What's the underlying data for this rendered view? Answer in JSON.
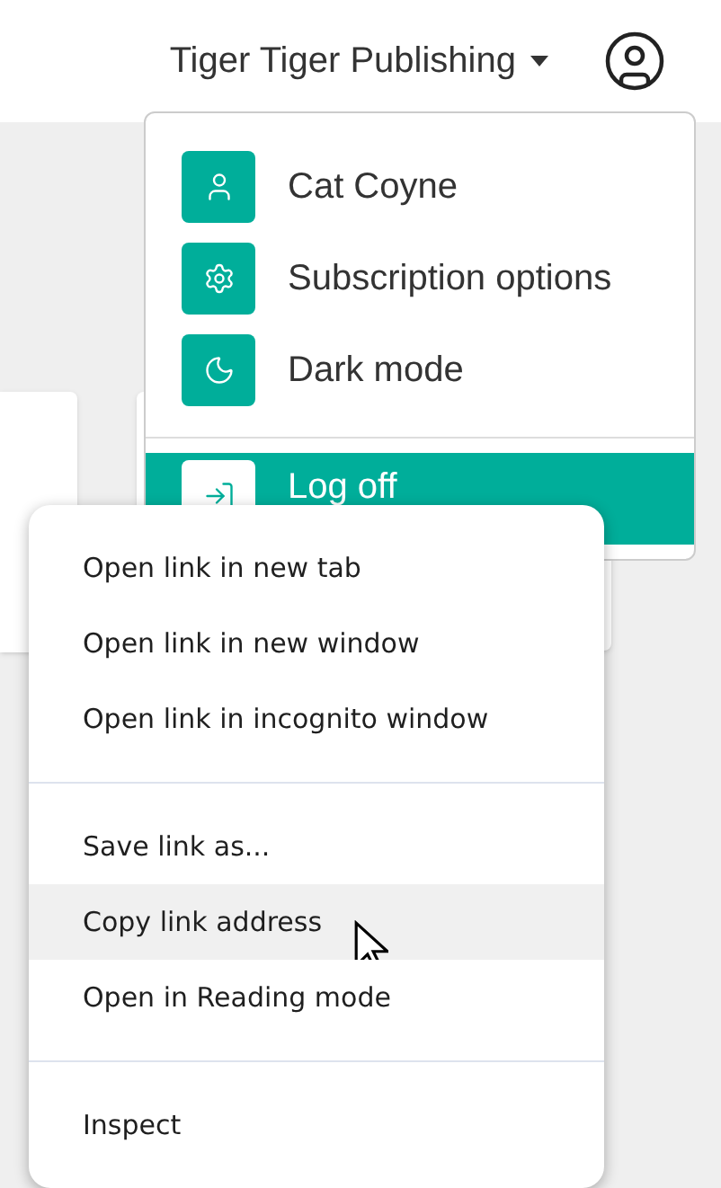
{
  "header": {
    "org_name": "Tiger Tiger Publishing"
  },
  "user_menu": {
    "items": [
      {
        "label": "Cat Coyne",
        "selected": false
      },
      {
        "label": "Subscription options",
        "selected": false
      },
      {
        "label": "Dark mode",
        "selected": false
      },
      {
        "label": "Log off",
        "selected": true
      }
    ]
  },
  "context_menu": {
    "groups": [
      {
        "items": [
          {
            "label": "Open link in new tab",
            "selected": false
          },
          {
            "label": "Open link in new window",
            "selected": false
          },
          {
            "label": "Open link in incognito window",
            "selected": false
          }
        ]
      },
      {
        "items": [
          {
            "label": "Save link as...",
            "selected": false
          },
          {
            "label": "Copy link address",
            "selected": true
          },
          {
            "label": "Open in Reading mode",
            "selected": false
          }
        ]
      },
      {
        "items": [
          {
            "label": "Inspect",
            "selected": false
          }
        ]
      }
    ]
  }
}
